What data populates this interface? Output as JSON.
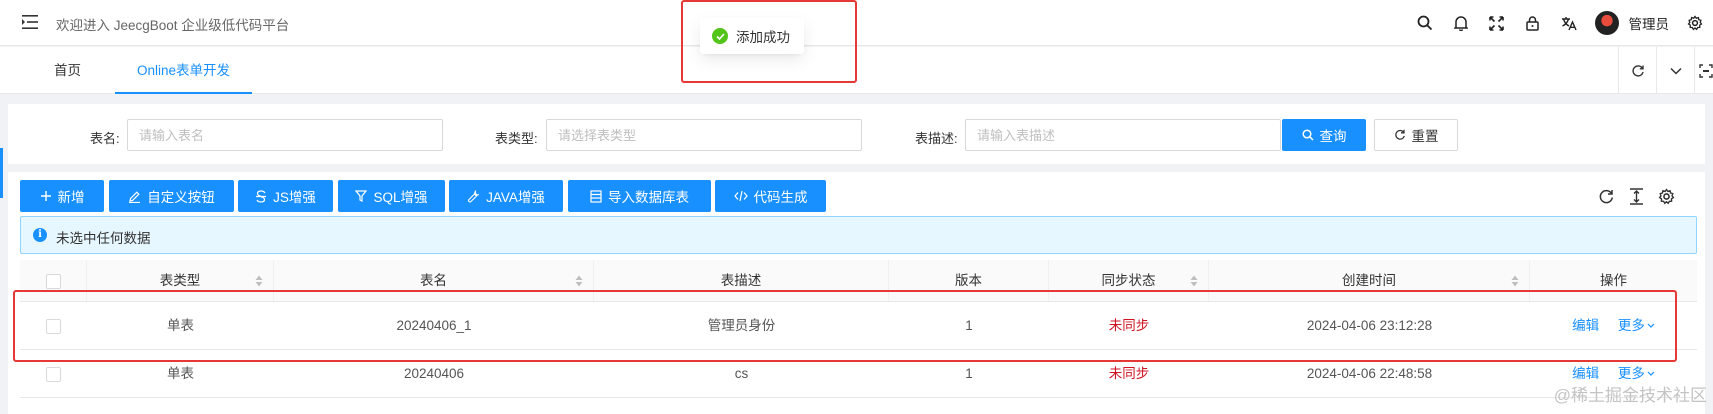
{
  "header": {
    "welcome": "欢迎进入 JeecgBoot 企业级低代码平台",
    "username": "管理员",
    "icons": [
      "search-icon",
      "bell-icon",
      "fullscreen-icon",
      "lock-icon",
      "translate-icon",
      "gear-icon"
    ]
  },
  "tabs": [
    {
      "label": "首页",
      "active": false
    },
    {
      "label": "Online表单开发",
      "active": true
    }
  ],
  "search": {
    "table_name_label": "表名:",
    "table_name_placeholder": "请输入表名",
    "table_type_label": "表类型:",
    "table_type_placeholder": "请选择表类型",
    "table_desc_label": "表描述:",
    "table_desc_placeholder": "请输入表描述",
    "query_button": "查询",
    "reset_button": "重置"
  },
  "toolbar": {
    "add": "新增",
    "custom_button": "自定义按钮",
    "js_enhance": "JS增强",
    "sql_enhance": "SQL增强",
    "java_enhance": "JAVA增强",
    "import_db": "导入数据库表",
    "code_gen": "代码生成"
  },
  "alert": {
    "text": "未选中任何数据"
  },
  "table": {
    "columns": [
      "表类型",
      "表名",
      "表描述",
      "版本",
      "同步状态",
      "创建时间",
      "操作"
    ],
    "rows": [
      {
        "type": "单表",
        "name": "20240406_1",
        "desc": "管理员身份",
        "version": "1",
        "sync": "未同步",
        "created": "2024-04-06 23:12:28",
        "edit": "编辑",
        "more": "更多"
      },
      {
        "type": "单表",
        "name": "20240406",
        "desc": "cs",
        "version": "1",
        "sync": "未同步",
        "created": "2024-04-06 22:48:58",
        "edit": "编辑",
        "more": "更多"
      }
    ]
  },
  "toast": {
    "text": "添加成功"
  },
  "watermark": "@稀土掘金技术社区",
  "colors": {
    "primary": "#1890ff",
    "danger": "#cf1322",
    "success": "#52c41a",
    "annotation": "#e53935"
  }
}
